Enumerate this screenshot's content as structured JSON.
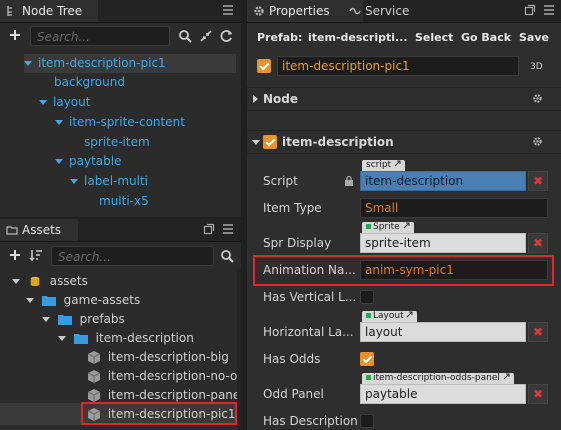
{
  "node_tree": {
    "tab_label": "Node Tree",
    "search_placeholder": "Search...",
    "items": [
      {
        "label": "item-description-pic1"
      },
      {
        "label": "background"
      },
      {
        "label": "layout"
      },
      {
        "label": "item-sprite-content"
      },
      {
        "label": "sprite-item"
      },
      {
        "label": "paytable"
      },
      {
        "label": "label-multi"
      },
      {
        "label": "multi-x5"
      }
    ]
  },
  "assets": {
    "tab_label": "Assets",
    "search_placeholder": "Search...",
    "items": [
      {
        "label": "assets"
      },
      {
        "label": "game-assets"
      },
      {
        "label": "prefabs"
      },
      {
        "label": "item-description"
      },
      {
        "label": "item-description-big"
      },
      {
        "label": "item-description-no-odd"
      },
      {
        "label": "item-description-panel"
      },
      {
        "label": "item-description-pic1"
      }
    ]
  },
  "inspector": {
    "tabs": [
      {
        "label": "Properties"
      },
      {
        "label": "Service"
      }
    ],
    "prefab_label": "Prefab:",
    "prefab_name": "item-descripti...",
    "select_label": "Select",
    "goback_label": "Go Back",
    "save_label": "Save",
    "node_name": "item-description-pic1",
    "dim_label": "3D",
    "node_section": "Node",
    "component_section": "item-description",
    "properties": {
      "script": {
        "label": "Script",
        "tag": "script",
        "value": "item-description"
      },
      "item_type": {
        "label": "Item Type",
        "value": "Small"
      },
      "spr_display": {
        "label": "Spr Display",
        "tag": "Sprite",
        "value": "sprite-item"
      },
      "animation_name": {
        "label": "Animation Na...",
        "value": "anim-sym-pic1"
      },
      "has_vertical": {
        "label": "Has Vertical L...",
        "checked": false
      },
      "horizontal": {
        "label": "Horizontal La...",
        "tag": "Layout",
        "value": "layout"
      },
      "has_odds": {
        "label": "Has Odds",
        "checked": true
      },
      "odd_panel": {
        "label": "Odd Panel",
        "tag": "item-description-odds-panel",
        "value": "paytable"
      },
      "has_description": {
        "label": "Has Description",
        "checked": false
      }
    },
    "clear_glyph": "✖"
  },
  "colors": {
    "tree_text": "#3ea8e8",
    "highlight": "#e3242b",
    "accent_orange": "#e8912d"
  }
}
